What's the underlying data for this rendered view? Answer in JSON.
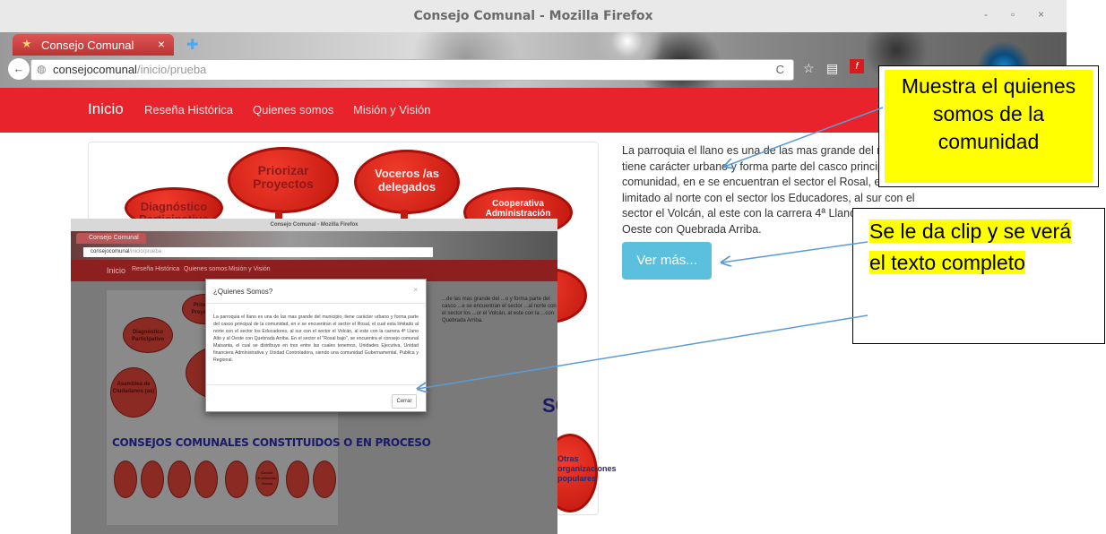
{
  "window": {
    "title": "Consejo Comunal - Mozilla Firefox",
    "controls": [
      "-",
      "▫",
      "×"
    ]
  },
  "browser": {
    "tab_label": "Consejo Comunal",
    "tab_close": "×",
    "url_host": "consejocomunal",
    "url_path": "/inicio/prueba",
    "reload": "C"
  },
  "nav": {
    "brand": "Inicio",
    "items": [
      "Reseña Histórica",
      "Quienes somos",
      "Misión y Visión"
    ]
  },
  "bubbles": {
    "priorizar": "Priorizar Proyectos",
    "voceros": "Voceros /as delegados",
    "diagnostico": "Diagnóstico Participativo",
    "cooperativa": "Cooperativa Administración",
    "otras": "Otras organizaciones populares"
  },
  "main_text": "La parroquia el llano es una de las mas grande del municipio, tiene carácter urbano y forma parte del casco principal de la comunidad, en e se encuentran el sector el Rosal, el cual esta limitado al norte con el sector los Educadores, al sur con el sector el Volcán, al este con la carrera 4ª Llano Alto y al Oeste con Quebrada Arriba.",
  "ver_mas": "Ver más...",
  "inset": {
    "title": "Consejo Comunal - Mozilla Firefox",
    "tab": "Consejo Comunal",
    "url_host": "consejocomunal",
    "url_path": "/inicio/prueba",
    "nav": [
      "Inicio",
      "Reseña Histórica",
      "Quienes somos",
      "Misión y Visión"
    ],
    "bubbles": [
      "Priorizar Proyectos",
      "Diagnóstico Participativo",
      "Asamblea de Ciudadanos (as)",
      "Comité Protección Social"
    ],
    "consejos_heading": "CONSEJOS COMUNALES CONSTITUIDOS O EN PROCESO",
    "side_text": "...de las mas grande del ...o y forma parte del casco ...e se encuentran el sector ...al norte con el sector los ...or el Volcán, al este con la ...con Quebrada Arriba.",
    "so_text": "SO"
  },
  "modal": {
    "title": "¿Quienes Somos?",
    "close": "×",
    "body": "La parroquia el llano es una de las mas grande del municipio, tiene carácter urbano y forma parte del casco principal de la comunidad, en e se encuentran el sector el Rosal, el cual esta limitado al norte con el sector los Educadores, al sur con el sector el Volcán, al este con la carrera 4ª Llano Alto y al Oeste con Quebrada Arriba. En el sector el \"Rosal bajo\", se encuentra el consejo comunal Maisanta, el cual se distribuye en tres entre las cuales tenemos, Unidades Ejecutiva, Unidad financiera Administrativa y Unidad Controladora, siendo una comunidad Gubernamental, Publica y Regional.",
    "button": "Cerrar"
  },
  "callouts": {
    "first": "Muestra el quienes somos de la comunidad",
    "second": "Se le da clip y se verá el texto completo"
  },
  "colors": {
    "navbar": "#e8232b",
    "ver_mas": "#5bc0de",
    "highlight": "#ffff00",
    "arrow": "#5b9bd5"
  }
}
